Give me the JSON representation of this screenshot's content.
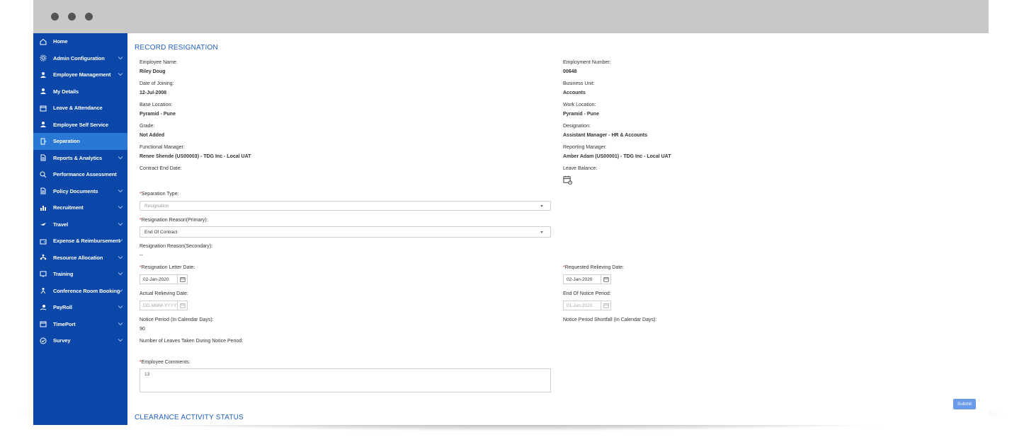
{
  "sidebar": {
    "items": [
      {
        "label": "Home",
        "icon": "home-icon",
        "chevron": false,
        "active": false
      },
      {
        "label": "Admin Configuration",
        "icon": "gear-icon",
        "chevron": true,
        "active": false
      },
      {
        "label": "Employee Management",
        "icon": "user-icon",
        "chevron": true,
        "active": false
      },
      {
        "label": "My Details",
        "icon": "user-icon",
        "chevron": false,
        "active": false
      },
      {
        "label": "Leave & Attendance",
        "icon": "calendar-icon",
        "chevron": false,
        "active": false
      },
      {
        "label": "Employee Self Service",
        "icon": "user-icon",
        "chevron": false,
        "active": false
      },
      {
        "label": "Separation",
        "icon": "door-exit-icon",
        "chevron": false,
        "active": true
      },
      {
        "label": "Reports & Analytics",
        "icon": "document-icon",
        "chevron": true,
        "active": false
      },
      {
        "label": "Performance Assessment",
        "icon": "magnifier-icon",
        "chevron": false,
        "active": false
      },
      {
        "label": "Policy Documents",
        "icon": "document-icon",
        "chevron": true,
        "active": false
      },
      {
        "label": "Recruitment",
        "icon": "bar-chart-icon",
        "chevron": true,
        "active": false
      },
      {
        "label": "Travel",
        "icon": "airplane-icon",
        "chevron": true,
        "active": false
      },
      {
        "label": "Expense & Reimbursement",
        "icon": "wallet-icon",
        "chevron": true,
        "active": false
      },
      {
        "label": "Resource Allocation",
        "icon": "network-icon",
        "chevron": true,
        "active": false
      },
      {
        "label": "Training",
        "icon": "presentation-icon",
        "chevron": true,
        "active": false
      },
      {
        "label": "Conference Room Booking",
        "icon": "meeting-icon",
        "chevron": true,
        "active": false
      },
      {
        "label": "PayRoll",
        "icon": "hand-money-icon",
        "chevron": true,
        "active": false
      },
      {
        "label": "TimePort",
        "icon": "calendar-icon",
        "chevron": true,
        "active": false
      },
      {
        "label": "Survey",
        "icon": "check-circle-icon",
        "chevron": true,
        "active": false
      }
    ]
  },
  "record": {
    "title": "RECORD RESIGNATION",
    "employee_name_label": "Employee Name:",
    "employee_name": "Riley Doug",
    "employment_number_label": "Employment Number:",
    "employment_number": "00648",
    "doj_label": "Date of Joining:",
    "doj": "12-Jul-2008",
    "business_unit_label": "Business Unit:",
    "business_unit": "Accounts",
    "base_location_label": "Base Location:",
    "base_location": "Pyramid - Pune",
    "work_location_label": "Work Location:",
    "work_location": "Pyramid - Pune",
    "grade_label": "Grade:",
    "grade": "Not Added",
    "designation_label": "Designation:",
    "designation": "Assistant Manager - HR & Accounts",
    "functional_manager_label": "Functional Manager:",
    "functional_manager": "Renee Shende (US00003) - TDG Inc - Local UAT",
    "reporting_manager_label": "Reporting Manager:",
    "reporting_manager": "Amber Adam (US00001) - TDG Inc - Local UAT",
    "contract_end_label": "Contract End Date:",
    "leave_balance_label": "Leave Balance:",
    "separation_type_label": "Separation Type:",
    "separation_type": "Resignation",
    "reason_primary_label": "Resignation Reason(Primary):",
    "reason_primary": "End Of Contract",
    "reason_secondary_label": "Resignation Reason(Secondary):",
    "reason_secondary": "--",
    "letter_date_label": "Resignation Letter Date:",
    "letter_date": "02-Jan-2020",
    "requested_relieving_label": "Requested Relieving Date:",
    "requested_relieving": "02-Jan-2020",
    "actual_relieving_label": "Actual Relieving Date:",
    "actual_relieving_placeholder": "DD-MMM-YYYY",
    "end_notice_label": "End Of Notice Period:",
    "end_notice": "01-Jun-2020",
    "notice_period_label": "Notice Period (In Calendar Days):",
    "notice_period": "90",
    "notice_shortfall_label": "Notice Period Shortfall (In Calendar Days):",
    "leaves_taken_label": "Number of Leaves Taken During Notice Period:",
    "comments_label": "Employee Comments:",
    "comments": "13",
    "submit_label": "Submit",
    "required_mark": "*"
  },
  "clearance": {
    "title": "CLEARANCE ACTIVITY STATUS"
  },
  "colors": {
    "sidebar": "#0a47a9",
    "active": "#2a78d6",
    "accent": "#1f5fbf",
    "submit": "#6b9be8"
  }
}
